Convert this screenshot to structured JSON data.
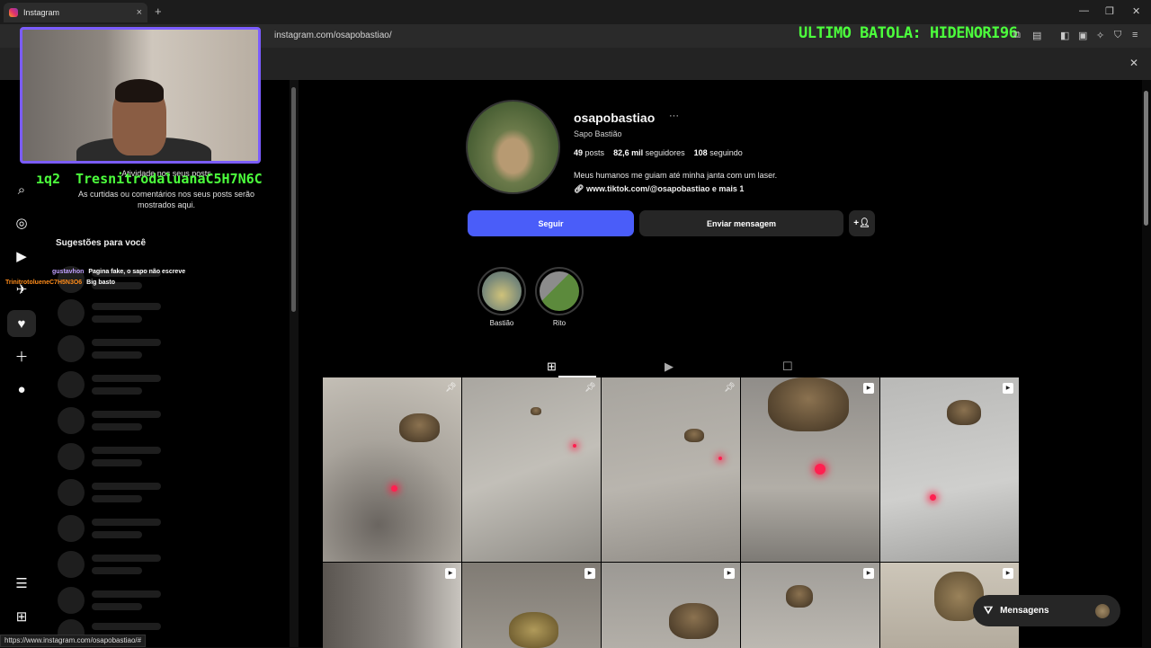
{
  "browser": {
    "tab_title": "Instagram",
    "tab_close": "×",
    "new_tab": "+",
    "url": "instagram.com/osapobastiao/",
    "status_url": "https://www.instagram.com/osapobastiao/#"
  },
  "overlay": {
    "banner": "ULTIMO BATOLA: HIDENORI96",
    "chat_name_left": "ıq2",
    "chat_name": "TresnitrodaluanaC5H7N6C",
    "chat_messages": [
      {
        "user": "gustavhon",
        "text": "Pagina fake, o sapo não escreve",
        "user_color": "#c0a0ff"
      },
      {
        "user": "TrinitrotolueneC7H5N3O6",
        "text": "Big basto",
        "user_color": "#ff8c1a"
      }
    ]
  },
  "notifications": {
    "title_partial": "Atividade nos seus posts",
    "desc_line1": "As curtidas ou comentários nos seus posts serão",
    "desc_line2": "mostrados aqui.",
    "suggestions_title": "Sugestões para você"
  },
  "profile": {
    "username": "osapobastiao",
    "more": "···",
    "full_name": "Sapo Bastião",
    "posts_count": "49",
    "posts_label": "posts",
    "followers_count": "82,6 mil",
    "followers_label": "seguidores",
    "following_count": "108",
    "following_label": "seguindo",
    "bio": "Meus humanos me guiam até minha janta com um laser.",
    "link": "www.tiktok.com/@osapobastiao e mais 1",
    "follow_button": "Seguir",
    "message_button": "Enviar mensagem",
    "add_button": "+𝄞"
  },
  "highlights": [
    {
      "label": "Bastião"
    },
    {
      "label": "Rito"
    }
  ],
  "messages_pill": {
    "label": "Mensagens"
  }
}
